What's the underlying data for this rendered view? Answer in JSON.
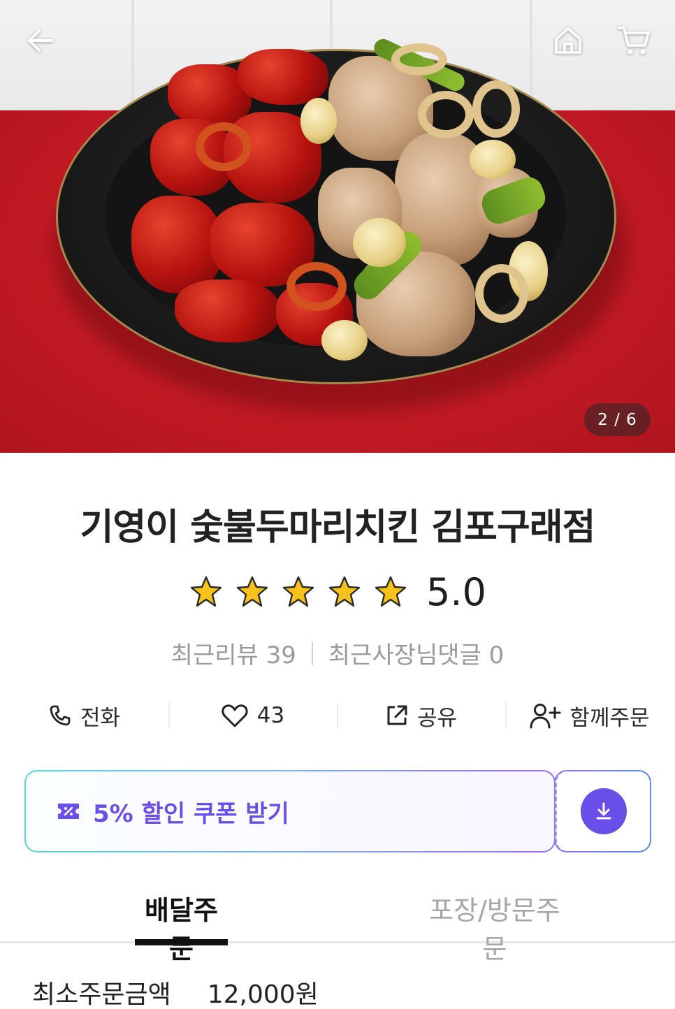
{
  "header": {
    "back_icon": "arrow-left-icon",
    "home_icon": "home-icon",
    "cart_icon": "cart-icon",
    "image_counter": "2 / 6"
  },
  "store": {
    "name": "기영이 숯불두마리치킨 김포구래점",
    "rating": {
      "stars": 5,
      "value": "5.0",
      "star_color": "#f6c21b"
    },
    "recent_reviews": "최근리뷰 39",
    "recent_owner_replies": "최근사장님댓글 0"
  },
  "actions": [
    {
      "icon": "phone-icon",
      "label": "전화"
    },
    {
      "icon": "heart-icon",
      "label": "43"
    },
    {
      "icon": "share-icon",
      "label": "공유"
    },
    {
      "icon": "add-user-icon",
      "label": "함께주문"
    }
  ],
  "coupon": {
    "label": "5% 할인 쿠폰 받기",
    "icon": "coupon-icon",
    "download_icon": "download-icon",
    "accent_color": "#6a4ee8"
  },
  "tabs": [
    {
      "label": "배달주문",
      "active": true
    },
    {
      "label": "포장/방문주문",
      "active": false
    }
  ],
  "min_order": {
    "label": "최소주문금액",
    "value": "12,000원"
  }
}
